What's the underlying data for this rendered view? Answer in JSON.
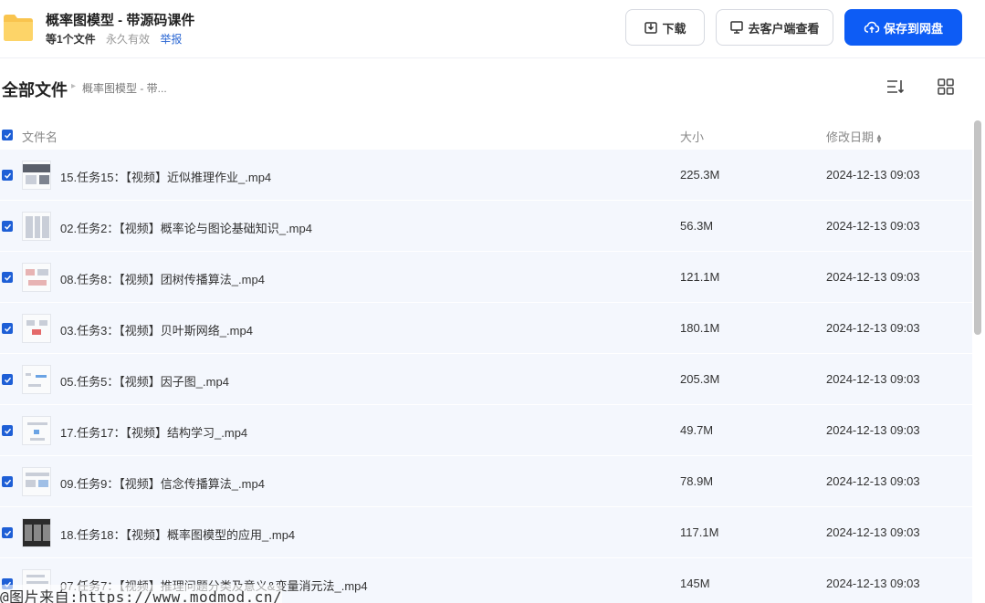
{
  "share": {
    "title": "概率图模型 - 带源码课件",
    "file_count": "等1个文件",
    "validity": "永久有效",
    "report": "举报"
  },
  "toolbar": {
    "download_label": "下载",
    "client_label": "去客户端查看",
    "save_label": "保存到网盘",
    "primary_color": "#0d5cf5"
  },
  "breadcrumb": {
    "root": "全部文件",
    "current": "概率图模型 - 带..."
  },
  "list": {
    "header": {
      "name": "文件名",
      "size": "大小",
      "date": "修改日期"
    },
    "rows": [
      {
        "name": "15.任务15：【视频】近似推理作业_.mp4",
        "size": "225.3M",
        "date": "2024-12-13 09:03"
      },
      {
        "name": "02.任务2：【视频】概率论与图论基础知识_.mp4",
        "size": "56.3M",
        "date": "2024-12-13 09:03"
      },
      {
        "name": "08.任务8：【视频】团树传播算法_.mp4",
        "size": "121.1M",
        "date": "2024-12-13 09:03"
      },
      {
        "name": "03.任务3：【视频】贝叶斯网络_.mp4",
        "size": "180.1M",
        "date": "2024-12-13 09:03"
      },
      {
        "name": "05.任务5：【视频】因子图_.mp4",
        "size": "205.3M",
        "date": "2024-12-13 09:03"
      },
      {
        "name": "17.任务17：【视频】结构学习_.mp4",
        "size": "49.7M",
        "date": "2024-12-13 09:03"
      },
      {
        "name": "09.任务9：【视频】信念传播算法_.mp4",
        "size": "78.9M",
        "date": "2024-12-13 09:03"
      },
      {
        "name": "18.任务18：【视频】概率图模型的应用_.mp4",
        "size": "117.1M",
        "date": "2024-12-13 09:03"
      },
      {
        "name": "07.任务7：【视频】推理问题分类及意义&变量消元法_.mp4",
        "size": "145M",
        "date": "2024-12-13 09:03"
      }
    ]
  },
  "watermark": "@图片来自:https://www.modmod.cn/"
}
